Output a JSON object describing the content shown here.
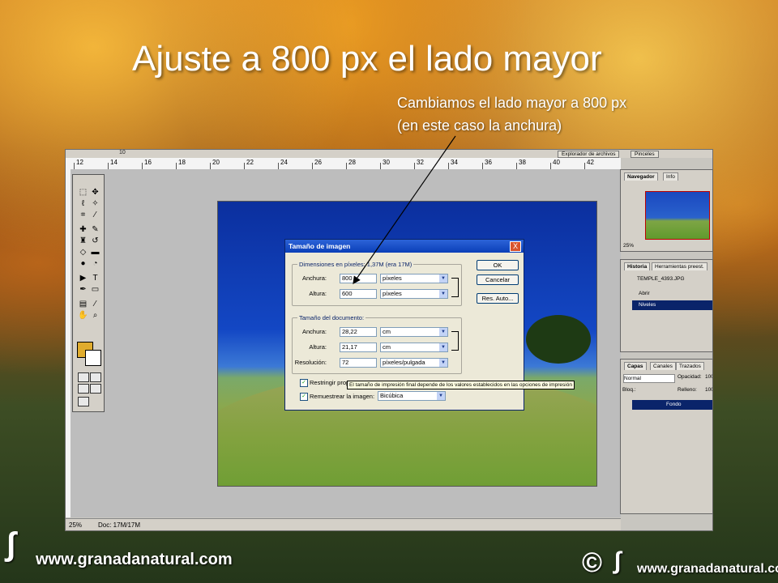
{
  "slide": {
    "title": "Ajuste a 800 px el lado mayor",
    "annotation_line1": "Cambiamos el lado mayor a 800 px",
    "annotation_line2": "(en este caso la anchura)"
  },
  "photoshop": {
    "options_bar": {
      "item1": "10",
      "item2": "Explorador de archivos",
      "item3": "Pinceles"
    },
    "ruler_numbers": [
      "12",
      "14",
      "16",
      "18",
      "20",
      "22",
      "24",
      "26",
      "28",
      "30",
      "32",
      "34",
      "36",
      "38",
      "40",
      "42"
    ],
    "status": {
      "zoom": "25%",
      "doc": "Doc: 17M/17M"
    }
  },
  "dialog": {
    "title": "Tamaño de imagen",
    "close": "X",
    "pixel_dims_label": "Dimensiones en píxeles: 1,37M (era 17M)",
    "width_label": "Anchura:",
    "width_value": "800",
    "width_unit": "píxeles",
    "height_label": "Altura:",
    "height_value": "600",
    "height_unit": "píxeles",
    "doc_size_label": "Tamaño del documento:",
    "doc_width_label": "Anchura:",
    "doc_width_value": "28,22",
    "doc_width_unit": "cm",
    "doc_height_label": "Altura:",
    "doc_height_value": "21,17",
    "doc_height_unit": "cm",
    "resolution_label": "Resolución:",
    "resolution_value": "72",
    "resolution_unit": "píxeles/pulgada",
    "constrain_label": "Restringir prop",
    "resample_label": "Remuestrear la imagen:",
    "resample_value": "Bicúbica",
    "ok": "OK",
    "cancel": "Cancelar",
    "auto": "Res. Auto...",
    "tooltip": "El tamaño de impresión final depende de los valores establecidos en las opciones de impresión"
  },
  "palettes": {
    "navigator_tab": "Navegador",
    "info_tab": "Info",
    "navigator_zoom": "25%",
    "history_tab": "Historia",
    "actions_tab": "Herramientas preest.",
    "history_snapshot": "TEMPLE_4393.JPG",
    "history_item1": "Abrir",
    "history_item2": "Niveles",
    "layers_tab": "Capas",
    "channels_tab": "Canales",
    "paths_tab": "Trazados",
    "blend_mode": "Normal",
    "opacity_label": "Opacidad:",
    "opacity_value": "100",
    "lock_label": "Bloq.:",
    "fill_label": "Relleno:",
    "fill_value": "100",
    "layer_name": "Fondo"
  },
  "footer": {
    "left_logo": "www.granadanatural.com",
    "right_logo": "www.granadanatural.com",
    "copyright": "©"
  }
}
